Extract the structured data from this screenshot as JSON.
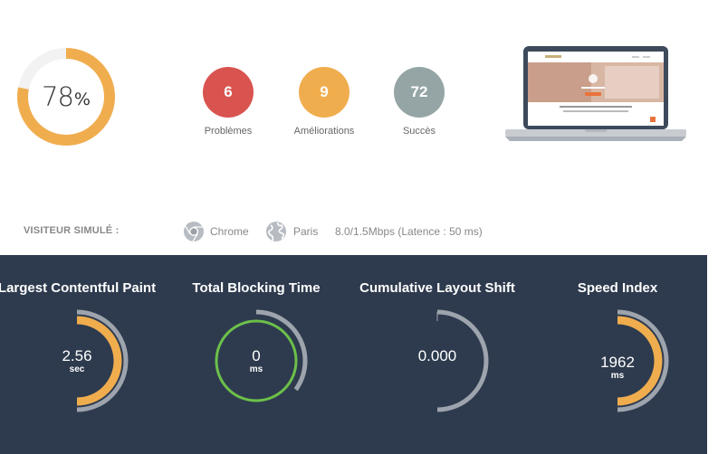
{
  "score": {
    "value": "78",
    "unit": "%",
    "fraction": 0.78,
    "color": "#f0ad4e",
    "track_color": "#ffffff"
  },
  "stats": [
    {
      "count": "6",
      "label": "Problèmes",
      "color": "#d9534f"
    },
    {
      "count": "9",
      "label": "Améliorations",
      "color": "#f0ad4e"
    },
    {
      "count": "72",
      "label": "Succès",
      "color": "#95a5a6"
    }
  ],
  "visitor": {
    "label": "VISITEUR SIMULÉ :",
    "browser_icon": "chrome-icon",
    "browser": "Chrome",
    "location_icon": "globe-icon",
    "location": "Paris",
    "network": "8.0/1.5Mbps (Latence : 50 ms)"
  },
  "metrics": [
    {
      "title": "Largest Contentful Paint",
      "value": "2.56",
      "unit": "sec",
      "fill_fraction": 0.5,
      "fill_color": "#f0ad4e",
      "track_fraction": 0.5,
      "ring": "arc"
    },
    {
      "title": "Total Blocking Time",
      "value": "0",
      "unit": "ms",
      "fill_fraction": 1.0,
      "fill_color": "#6cc04a",
      "track_fraction": 0.35,
      "ring": "full"
    },
    {
      "title": "Cumulative Layout Shift",
      "value": "0.000",
      "unit": "",
      "fill_fraction": 0.0,
      "fill_color": "#f0ad4e",
      "track_fraction": 0.5,
      "ring": "arc"
    },
    {
      "title": "Speed Index",
      "value": "1962",
      "unit": "ms",
      "fill_fraction": 0.5,
      "fill_color": "#f0ad4e",
      "track_fraction": 0.5,
      "ring": "arc"
    }
  ],
  "colors": {
    "panel_bg": "#2e3b4e",
    "gauge_track": "#9ea4ad"
  }
}
